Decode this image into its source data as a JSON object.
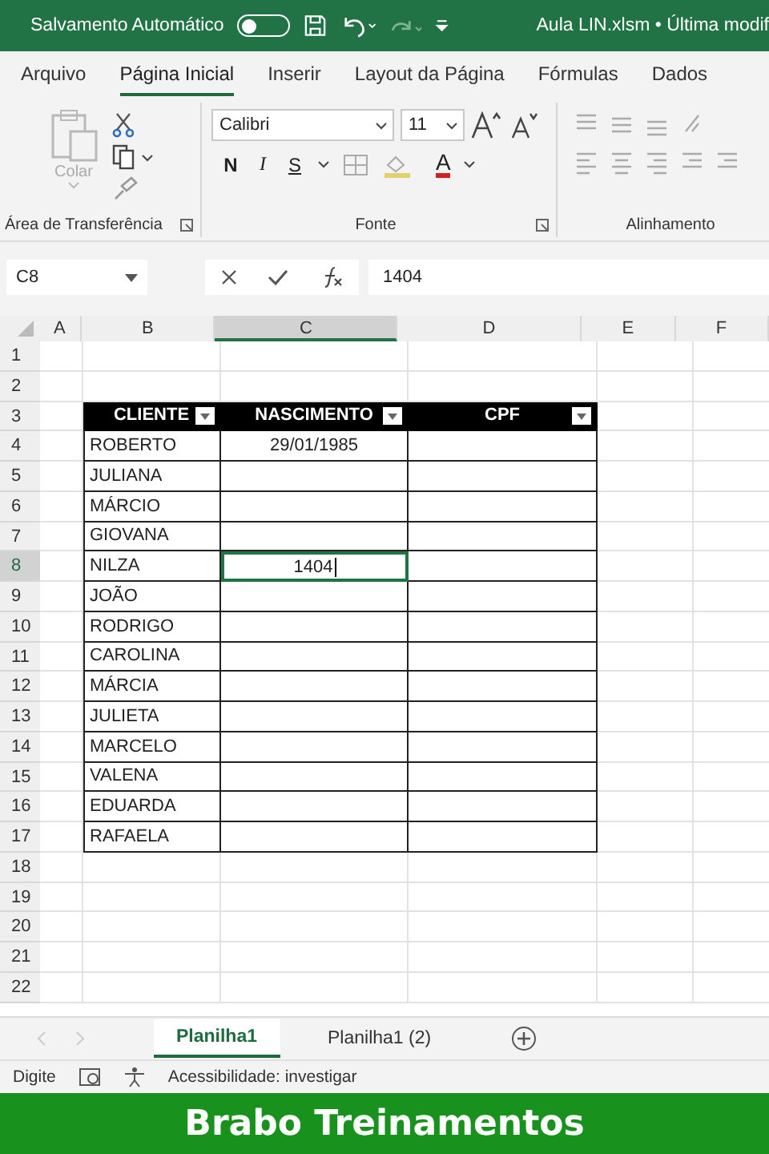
{
  "title_bar": {
    "autosave_label": "Salvamento Automático",
    "autosave_on": false,
    "file_title": "Aula LIN.xlsm • Última modif"
  },
  "ribbon_tabs": [
    {
      "label": "Arquivo",
      "selected": false
    },
    {
      "label": "Página Inicial",
      "selected": true
    },
    {
      "label": "Inserir",
      "selected": false
    },
    {
      "label": "Layout da Página",
      "selected": false
    },
    {
      "label": "Fórmulas",
      "selected": false
    },
    {
      "label": "Dados",
      "selected": false
    }
  ],
  "ribbon": {
    "clipboard": {
      "paste_label": "Colar",
      "group_label": "Área de Transferência"
    },
    "font": {
      "font_name": "Calibri",
      "font_size": "11",
      "bold_label": "N",
      "italic_label": "I",
      "underline_label": "S",
      "color_letter": "A",
      "group_label": "Fonte"
    },
    "alignment": {
      "group_label": "Alinhamento"
    }
  },
  "formula_bar": {
    "name_box": "C8",
    "formula": "1404"
  },
  "columns": [
    {
      "label": "A",
      "selected": false
    },
    {
      "label": "B",
      "selected": false
    },
    {
      "label": "C",
      "selected": true
    },
    {
      "label": "D",
      "selected": false
    },
    {
      "label": "E",
      "selected": false
    },
    {
      "label": "F",
      "selected": false
    }
  ],
  "table_headers": [
    "CLIENTE",
    "NASCIMENTO",
    "CPF"
  ],
  "rows": [
    {
      "number": "1",
      "selected": false,
      "kind": "blank"
    },
    {
      "number": "2",
      "selected": false,
      "kind": "blank"
    },
    {
      "number": "3",
      "selected": false,
      "kind": "header"
    },
    {
      "number": "4",
      "selected": false,
      "kind": "record",
      "cliente": "ROBERTO",
      "nascimento": "29/01/1985",
      "editing": false
    },
    {
      "number": "5",
      "selected": false,
      "kind": "record",
      "cliente": "JULIANA",
      "editing": false
    },
    {
      "number": "6",
      "selected": false,
      "kind": "record",
      "cliente": "MÁRCIO",
      "editing": false
    },
    {
      "number": "7",
      "selected": false,
      "kind": "record",
      "cliente": "GIOVANA",
      "editing": false
    },
    {
      "number": "8",
      "selected": true,
      "kind": "record",
      "cliente": "NILZA",
      "nascimento": "1404",
      "editing": true
    },
    {
      "number": "9",
      "selected": false,
      "kind": "record",
      "cliente": "JOÃO",
      "editing": false
    },
    {
      "number": "10",
      "selected": false,
      "kind": "record",
      "cliente": "RODRIGO",
      "editing": false
    },
    {
      "number": "11",
      "selected": false,
      "kind": "record",
      "cliente": "CAROLINA",
      "editing": false
    },
    {
      "number": "12",
      "selected": false,
      "kind": "record",
      "cliente": "MÁRCIA",
      "editing": false
    },
    {
      "number": "13",
      "selected": false,
      "kind": "record",
      "cliente": "JULIETA",
      "editing": false
    },
    {
      "number": "14",
      "selected": false,
      "kind": "record",
      "cliente": "MARCELO",
      "editing": false
    },
    {
      "number": "15",
      "selected": false,
      "kind": "record",
      "cliente": "VALENA",
      "editing": false
    },
    {
      "number": "16",
      "selected": false,
      "kind": "record",
      "cliente": "EDUARDA",
      "editing": false
    },
    {
      "number": "17",
      "selected": false,
      "kind": "record",
      "cliente": "RAFAELA",
      "editing": false
    },
    {
      "number": "18",
      "selected": false,
      "kind": "blank"
    },
    {
      "number": "19",
      "selected": false,
      "kind": "blank"
    },
    {
      "number": "20",
      "selected": false,
      "kind": "blank"
    },
    {
      "number": "21",
      "selected": false,
      "kind": "blank"
    },
    {
      "number": "22",
      "selected": false,
      "kind": "blank"
    }
  ],
  "sheet_tabs": [
    {
      "label": "Planilha1",
      "selected": true
    },
    {
      "label": "Planilha1 (2)",
      "selected": false
    }
  ],
  "status_bar": {
    "mode": "Digite",
    "accessibility": "Acessibilidade: investigar"
  },
  "banner": "Brabo Treinamentos"
}
